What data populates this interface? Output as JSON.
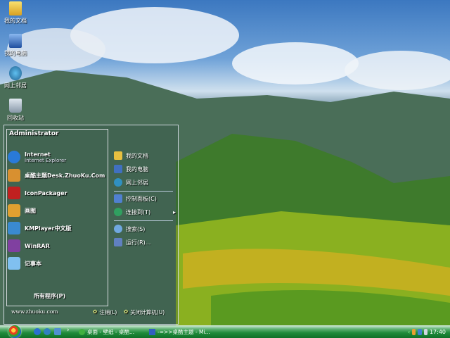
{
  "desktop_icons": [
    {
      "label": "我的文档"
    },
    {
      "label": "我的电脑"
    },
    {
      "label": "网上邻居"
    },
    {
      "label": "回收站"
    }
  ],
  "start_menu": {
    "user": "Administrator",
    "left_items": [
      {
        "label": "Internet",
        "sub": "Internet Explorer",
        "icon": "ie-icon",
        "color": "#2a7ad8"
      },
      {
        "label": "桌酷主题Desk.ZhuoKu.Com",
        "icon": "zhuoku-icon",
        "color": "#d89030"
      },
      {
        "label": "IconPackager",
        "icon": "iconpackager-icon",
        "color": "#c02020"
      },
      {
        "label": "画图",
        "icon": "paint-icon",
        "color": "#e0a030"
      },
      {
        "label": "KMPlayer中文版",
        "icon": "kmplayer-icon",
        "color": "#3a8ad0"
      },
      {
        "label": "WinRAR",
        "icon": "winrar-icon",
        "color": "#8040a0"
      },
      {
        "label": "记事本",
        "icon": "notepad-icon",
        "color": "#80c0f0"
      }
    ],
    "all_programs": "所有程序(P)",
    "right_items": [
      {
        "label": "我的文档",
        "icon": "documents-icon",
        "color": "#e8c040"
      },
      {
        "label": "我的电脑",
        "icon": "computer-icon",
        "color": "#4070c0"
      },
      {
        "label": "网上邻居",
        "icon": "network-icon",
        "color": "#3090c0"
      },
      {
        "label": "控制面板(C)",
        "icon": "control-panel-icon",
        "color": "#5080d0"
      },
      {
        "label": "连接到(T)",
        "icon": "connect-icon",
        "color": "#30a060",
        "arrow": "▸"
      },
      {
        "label": "搜索(S)",
        "icon": "search-icon",
        "color": "#70a8e0"
      },
      {
        "label": "运行(R)...",
        "icon": "run-icon",
        "color": "#6080c0"
      }
    ],
    "website": "www.zhuoku.com",
    "logoff": "注销(L)",
    "shutdown": "关闭计算机(U)"
  },
  "taskbar": {
    "tasks": [
      {
        "label": "桌面 - 壁纸 - 桌酷...",
        "icon": "browser-icon"
      },
      {
        "label": "-=>>桌酷主题 - Mi...",
        "icon": "word-icon"
      }
    ],
    "quick_launch_more": "›",
    "tray_expand": "‹",
    "clock": "17:40"
  }
}
